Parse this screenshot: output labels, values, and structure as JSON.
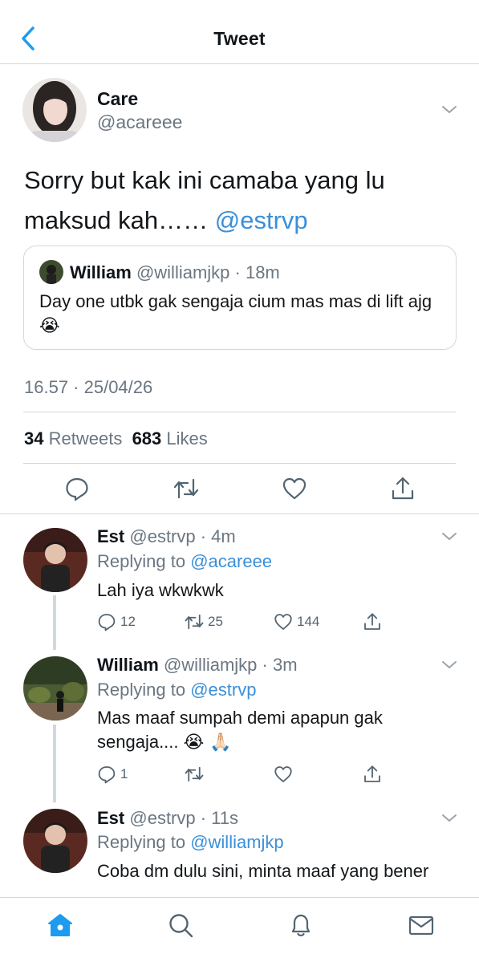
{
  "header": {
    "title": "Tweet"
  },
  "tweet": {
    "author_name": "Care",
    "author_handle": "@acareee",
    "text_main": "Sorry but kak ini camaba yang lu maksud kah……",
    "text_mention": "@estrvp",
    "quote": {
      "name": "William",
      "handle_time": "@williamjkp · 18m",
      "text": "Day one utbk gak sengaja cium mas mas di lift ajg",
      "emoji": "😭"
    },
    "timestamp": "16.57 · 25/04/26",
    "retweets_count": "34",
    "retweets_label": "Retweets",
    "likes_count": "683",
    "likes_label": "Likes"
  },
  "replies": [
    {
      "name": "Est",
      "handle_time": "@estrvp · 4m",
      "replying_label": "Replying to",
      "replying_to": "@acareee",
      "text": "Lah iya wkwkwk",
      "reply_count": "12",
      "retweet_count": "25",
      "like_count": "144"
    },
    {
      "name": "William",
      "handle_time": "@williamjkp · 3m",
      "replying_label": "Replying to",
      "replying_to": "@estrvp",
      "text_line1": "Mas maaf sumpah demi apapun gak",
      "text_line2": "sengaja....",
      "emoji": "😭 🙏🏻",
      "reply_count": "1",
      "retweet_count": "",
      "like_count": ""
    },
    {
      "name": "Est",
      "handle_time": "@estrvp · 11s",
      "replying_label": "Replying to",
      "replying_to": "@williamjkp",
      "text": "Coba dm dulu sini, minta maaf yang bener"
    }
  ],
  "icons": {
    "back": "chevron-left-icon",
    "more": "chevron-down-icon",
    "reply": "reply-icon",
    "retweet": "retweet-icon",
    "like": "heart-icon",
    "share": "share-icon",
    "home": "home-icon",
    "search": "search-icon",
    "notifications": "bell-icon",
    "messages": "mail-icon"
  },
  "colors": {
    "accent": "#1d9bf0",
    "mention": "#3a8fd9",
    "muted": "#6a7681"
  }
}
